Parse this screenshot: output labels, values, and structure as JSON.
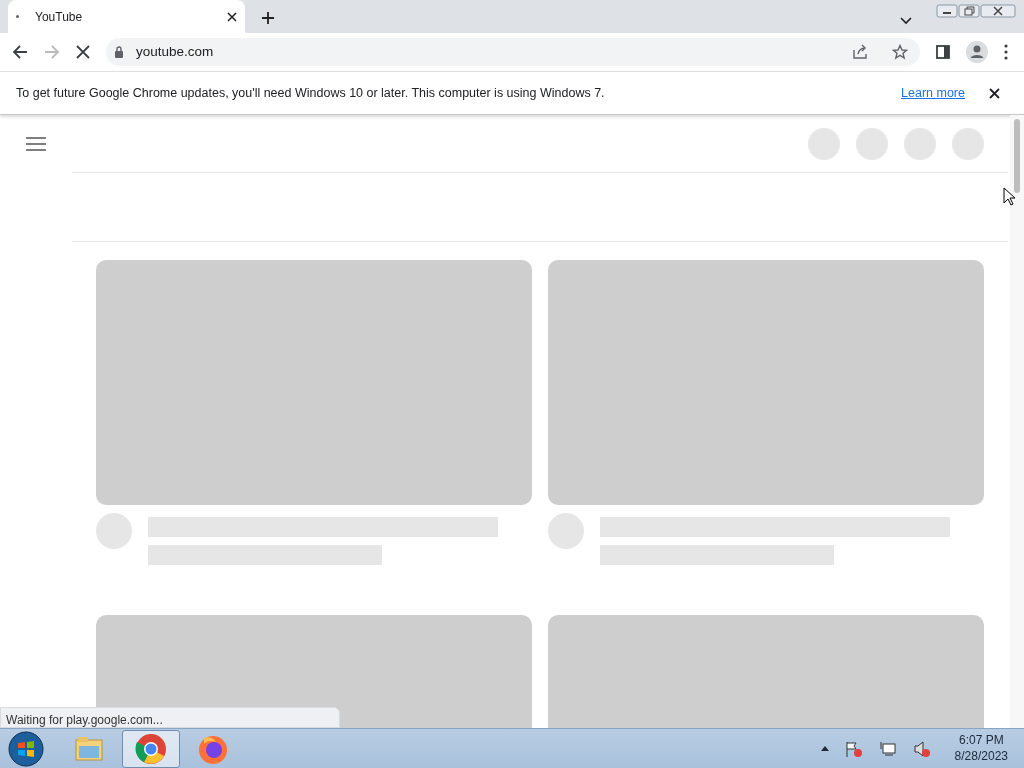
{
  "tab": {
    "title": "YouTube",
    "loading": true
  },
  "toolbar": {
    "address": "youtube.com",
    "back_disabled": false,
    "forward_disabled": true
  },
  "infobar": {
    "message": "To get future Google Chrome updates, you'll need Windows 10 or later. This computer is using Windows 7.",
    "link": "Learn more"
  },
  "status_bubble": "Waiting for play.google.com...",
  "taskbar": {
    "apps": [
      {
        "kind": "explorer",
        "selected": false
      },
      {
        "kind": "chrome",
        "selected": true
      },
      {
        "kind": "firefox",
        "selected": false
      }
    ],
    "time": "6:07 PM",
    "date": "8/28/2023"
  }
}
